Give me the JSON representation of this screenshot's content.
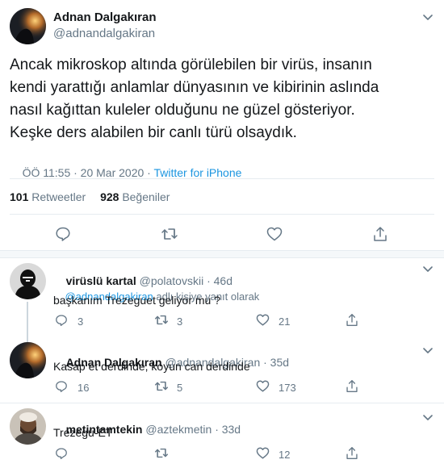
{
  "main_tweet": {
    "author_name": "Adnan Dalgakıran",
    "author_handle": "@adnandalgakiran",
    "text_lines": [
      "Ancak mikroskop altında görülebilen bir virüs, insanın",
      "kendi yarattığı anlamlar dünyasının ve kibirinin aslında",
      "nasıl kağıttan kuleler olduğunu ne güzel gösteriyor.",
      "Keşke ders alabilen bir canlı türü olsaydık."
    ],
    "time_date": "ÖÖ 11:55 · 20 Mar 2020 · ",
    "source": "Twitter for iPhone",
    "retweet_count": "101",
    "retweet_label": "Retweetler",
    "like_count": "928",
    "like_label": "Beğeniler"
  },
  "replies": [
    {
      "name": "virüslü kartal",
      "handle": "@polatovskii",
      "age": "· 46d",
      "reply_to_handle": "@adnandalgakiran",
      "reply_to_suffix": " adlı kişiye yanıt olarak",
      "text": "başkanım Trezeguet geliyor mu ?",
      "replies": "3",
      "retweets": "3",
      "likes": "21"
    },
    {
      "name": "Adnan Dalgakıran",
      "handle": "@adnandalgakiran",
      "age": "· 35d",
      "text": "Kasap et derdinde, koyun can derdinde",
      "replies": "16",
      "retweets": "5",
      "likes": "173"
    },
    {
      "name": "metintamtekin",
      "handle": "@aztekmetin",
      "age": "· 33d",
      "text": "Trezegu-ET",
      "replies": "",
      "retweets": "",
      "likes": "12"
    }
  ],
  "colors": {
    "link": "#1b95e0",
    "muted": "#657786",
    "divider": "#e6ecf0"
  },
  "icons": [
    "chevron-down-icon",
    "reply-icon",
    "retweet-icon",
    "like-icon",
    "share-icon"
  ]
}
